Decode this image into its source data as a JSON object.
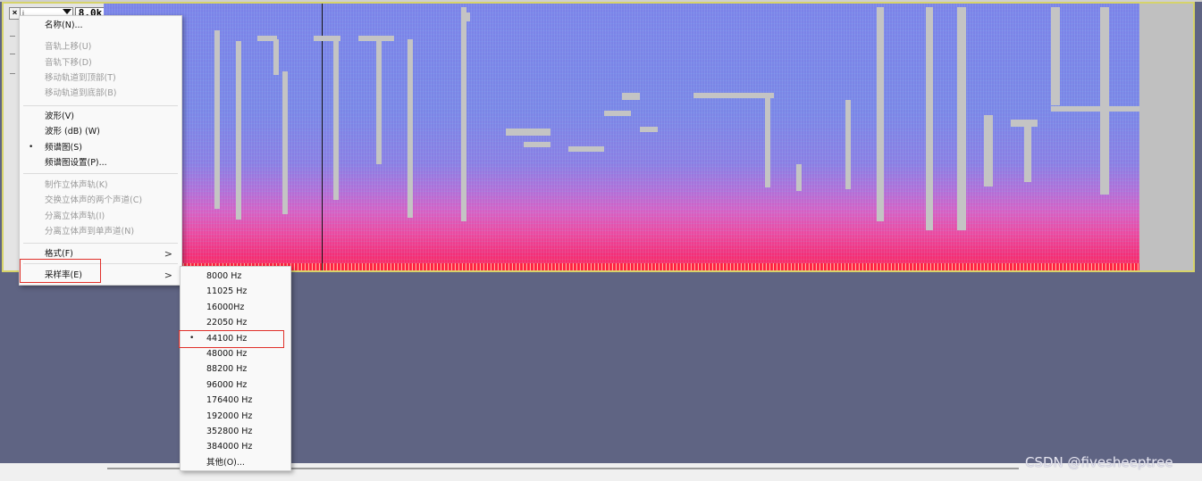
{
  "track": {
    "close_label": "×",
    "name": "i",
    "scale_top": "8.0k"
  },
  "context_menu": {
    "items": [
      {
        "label": "名称(N)...",
        "enabled": true
      },
      {
        "label": "音轨上移(U)",
        "enabled": false
      },
      {
        "label": "音轨下移(D)",
        "enabled": false
      },
      {
        "label": "移动轨道到顶部(T)",
        "enabled": false
      },
      {
        "label": "移动轨道到底部(B)",
        "enabled": false
      },
      {
        "label": "波形(V)",
        "enabled": true
      },
      {
        "label": "波形 (dB) (W)",
        "enabled": true
      },
      {
        "label": "频谱图(S)",
        "enabled": true,
        "checked": true
      },
      {
        "label": "频谱图设置(P)...",
        "enabled": true
      },
      {
        "label": "制作立体声轨(K)",
        "enabled": false
      },
      {
        "label": "交换立体声的两个声道(C)",
        "enabled": false
      },
      {
        "label": "分离立体声轨(I)",
        "enabled": false
      },
      {
        "label": "分离立体声到单声道(N)",
        "enabled": false
      },
      {
        "label": "格式(F)",
        "enabled": true,
        "submenu": true
      },
      {
        "label": "采样率(E)",
        "enabled": true,
        "submenu": true,
        "highlighted": true
      }
    ],
    "bullet": "•",
    "arrow": ">"
  },
  "sample_rate_menu": {
    "items": [
      {
        "label": "8000 Hz"
      },
      {
        "label": "11025 Hz"
      },
      {
        "label": "16000Hz"
      },
      {
        "label": "22050 Hz"
      },
      {
        "label": "44100 Hz",
        "checked": true,
        "highlighted": true
      },
      {
        "label": "48000 Hz"
      },
      {
        "label": "88200 Hz"
      },
      {
        "label": "96000 Hz"
      },
      {
        "label": "176400 Hz"
      },
      {
        "label": "192000 Hz"
      },
      {
        "label": "352800 Hz"
      },
      {
        "label": "384000 Hz"
      },
      {
        "label": "其他(O)..."
      }
    ]
  },
  "watermark": "CSDN @fivesheeptree",
  "colors": {
    "highlight_border": "#e0302a",
    "background": "#5f6483",
    "spectrogram_hidden_text": "#c4c4c4"
  }
}
